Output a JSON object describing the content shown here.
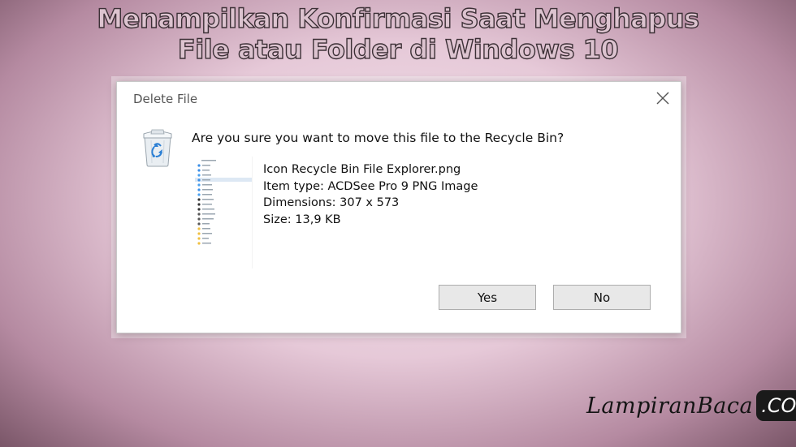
{
  "page": {
    "title_line1": "Menampilkan Konfirmasi Saat Menghapus",
    "title_line2": "File atau Folder di Windows 10"
  },
  "dialog": {
    "title": "Delete File",
    "close_icon": "close-icon",
    "question": "Are you sure you want to move this file to the Recycle Bin?",
    "file": {
      "name": "Icon Recycle Bin File Explorer.png",
      "item_type": "Item type: ACDSee Pro 9 PNG Image",
      "dimensions": "Dimensions: 307 x 573",
      "size": "Size: 13,9 KB"
    },
    "buttons": {
      "yes": "Yes",
      "no": "No"
    }
  },
  "watermark": {
    "script_text": "LampiranBaca",
    "box_text": ".COM"
  },
  "colors": {
    "background": "#e6c9d8",
    "recycle_blue": "#2b7fd4"
  }
}
